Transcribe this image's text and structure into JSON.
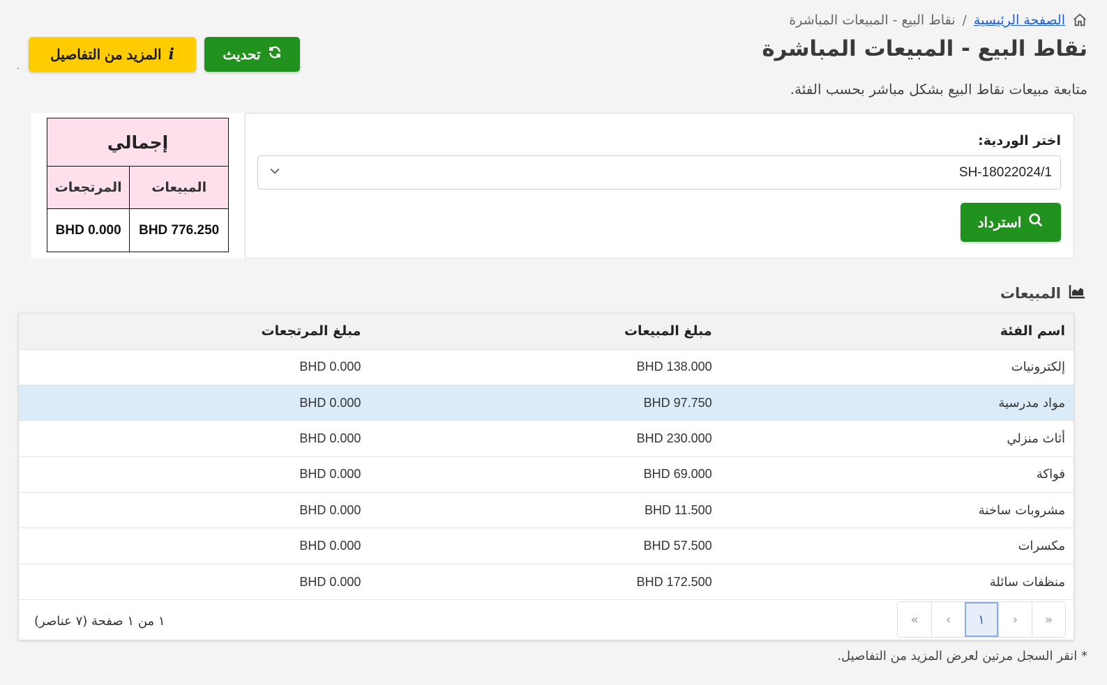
{
  "breadcrumb": {
    "home": "الصفحة الرئيسية",
    "separator": "/",
    "current": "نقاط البيع - المبيعات المباشرة"
  },
  "page": {
    "title": "نقاط البيع - المبيعات المباشرة",
    "subtitle": "متابعة مبيعات نقاط البيع بشكل مباشر بحسب الفئة."
  },
  "buttons": {
    "refresh": "تحديث",
    "more_details": "المزيد من التفاصيل",
    "fetch": "استرداد"
  },
  "totals": {
    "title": "إجمالي",
    "sales_label": "المبيعات",
    "returns_label": "المرتجعات",
    "sales_value": "BHD 776.250",
    "returns_value": "BHD 0.000"
  },
  "filter": {
    "label": "اختر الوردية:",
    "selected": "SH-18022024/1"
  },
  "sales": {
    "section_title": "المبيعات",
    "columns": [
      "اسم الفئة",
      "مبلغ المبيعات",
      "مبلغ المرتجعات"
    ],
    "rows": [
      {
        "category": "إلكترونيات",
        "sales": "BHD 138.000",
        "returns": "BHD 0.000"
      },
      {
        "category": "مواد مدرسية",
        "sales": "BHD 97.750",
        "returns": "BHD 0.000"
      },
      {
        "category": "أثاث منزلي",
        "sales": "BHD 230.000",
        "returns": "BHD 0.000"
      },
      {
        "category": "فواكة",
        "sales": "BHD 69.000",
        "returns": "BHD 0.000"
      },
      {
        "category": "مشروبات ساخنة",
        "sales": "BHD 11.500",
        "returns": "BHD 0.000"
      },
      {
        "category": "مكسرات",
        "sales": "BHD 57.500",
        "returns": "BHD 0.000"
      },
      {
        "category": "منظفات سائلة",
        "sales": "BHD 172.500",
        "returns": "BHD 0.000"
      }
    ],
    "highlighted_row": 1
  },
  "pager": {
    "info": "١ من ١ صفحة (٧ عناصر)",
    "current_page": "١",
    "first": "«",
    "prev": "‹",
    "next": "›",
    "last": "»"
  },
  "footnote": "* انقر السجل مرتين لعرض المزيد من التفاصيل.",
  "colors": {
    "green": "#22921f",
    "yellow": "#ffcc00",
    "pink": "#fde0ec",
    "link": "#1a5fd6",
    "highlight": "#dcebf8"
  }
}
